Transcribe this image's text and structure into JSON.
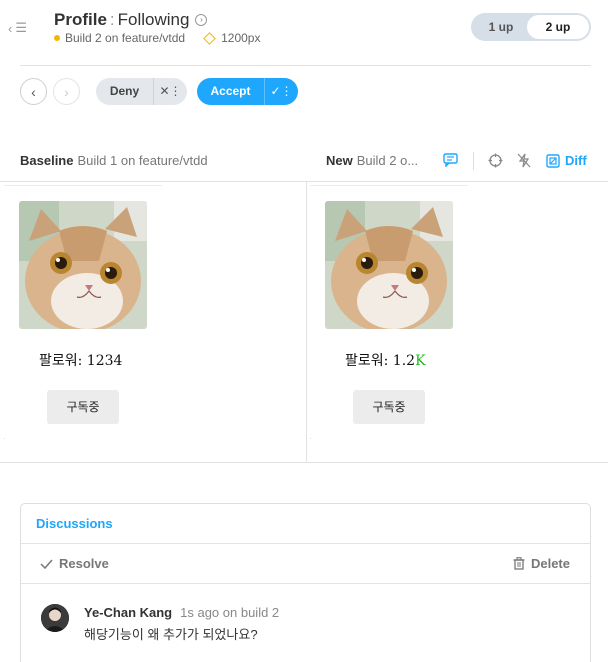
{
  "header": {
    "title_main": "Profile",
    "title_sep": ":",
    "title_story": "Following",
    "build_label": "Build 2 on feature/vtdd",
    "viewport_label": "1200px",
    "layout_toggle": {
      "one_up": "1 up",
      "two_up": "2 up",
      "selected": "2 up"
    }
  },
  "actions": {
    "prev_icon": "chevron-left",
    "next_icon": "chevron-right",
    "deny_label": "Deny",
    "accept_label": "Accept"
  },
  "comparison": {
    "baseline_label": "Baseline",
    "baseline_build": "Build 1 on feature/vtdd",
    "new_label": "New",
    "new_build": "Build 2 o...",
    "diff_label": "Diff"
  },
  "snapshots": {
    "baseline": {
      "followers_text": "팔로워: 1234",
      "button_label": "구독중"
    },
    "new": {
      "followers_prefix": "팔로워: 1.2",
      "followers_diff": "K",
      "button_label": "구독중"
    }
  },
  "discussions": {
    "title": "Discussions",
    "resolve_label": "Resolve",
    "delete_label": "Delete",
    "comment": {
      "author": "Ye-Chan Kang",
      "meta": "1s ago on build 2",
      "text": "해당기능이 왜 추가가 되었나요?"
    }
  },
  "colors": {
    "accent": "#1ea7fd",
    "warning": "#f5b400",
    "diff": "#1fb81f"
  }
}
